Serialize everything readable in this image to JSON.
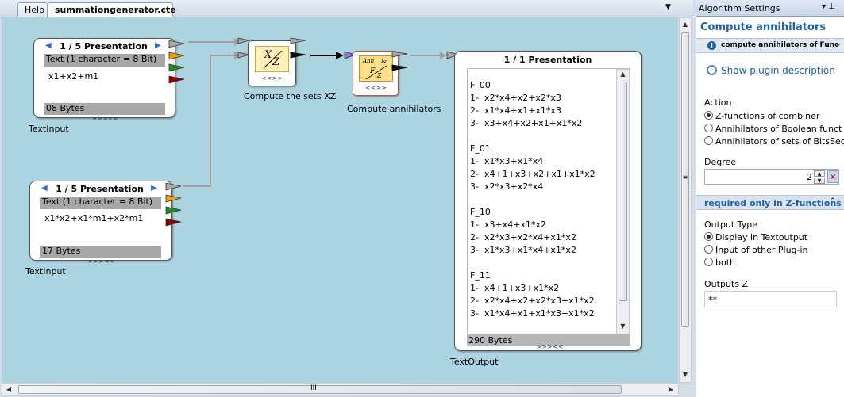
{
  "tabs": [
    {
      "label": "Help"
    },
    {
      "label": "summationgenerator.cte"
    }
  ],
  "tab_menu_glyph": "▼",
  "input1": {
    "title": "1 / 5 Presentation",
    "header": "Text (1 character = 8 Bit)",
    "content": "x1+x2+m1",
    "footer": "08 Bytes",
    "expander": ">>><<",
    "caption": "TextInput"
  },
  "input2": {
    "title": "1 / 5 Presentation",
    "header": "Text (1 character = 8 Bit)",
    "content": "x1*x2+x1*m1+x2*m1",
    "footer": "17 Bytes",
    "expander": ">>><<",
    "caption": "TextInput"
  },
  "plugin_xz": {
    "icon_x": "X",
    "icon_z": "Z",
    "ctrl": "<<>>",
    "caption": "Compute the sets XZ"
  },
  "plugin_ann": {
    "icon_top": "Ann",
    "icon_amp": "&",
    "icon_f": "F",
    "icon_z": "Z",
    "ctrl": "<<>>",
    "caption": "Compute annihilators"
  },
  "output": {
    "title": "1 / 1 Presentation",
    "lines": [
      "F_00",
      "1-  x2*x4+x2+x2*x3",
      "2-  x1*x4+x1+x1*x3",
      "3-  x3+x4+x2+x1+x1*x2",
      "",
      "F_01",
      "1-  x1*x3+x1*x4",
      "2-  x4+1+x3+x2+x1+x1*x2",
      "3-  x2*x3+x2*x4",
      "",
      "F_10",
      "1-  x3+x4+x1*x2",
      "2-  x2*x3+x2*x4+x1*x2",
      "3-  x1*x3+x1*x4+x1*x2",
      "",
      "F_11",
      "1-  x4+1+x3+x1*x2",
      "2-  x2*x4+x2+x2*x3+x1*x2",
      "3-  x1*x4+x1+x1*x3+x1*x2"
    ],
    "footer": "290 Bytes",
    "expander": ">>><<",
    "caption": "TextOutput"
  },
  "hscroll_grip": "III",
  "panel": {
    "header": "Algorithm Settings",
    "pin": "▾ ⊥",
    "title": "Compute annihilators",
    "info": "compute annihilators of Func",
    "show_desc": "Show plugin description",
    "action_label": "Action",
    "actions": [
      "Z-functions of combiner",
      "Annihilators of Boolean funct",
      "Annihilators of sets of BitsSec"
    ],
    "degree_label": "Degree",
    "degree_value": "2",
    "group": "required only in Z-functions",
    "output_type_label": "Output Type",
    "output_types": [
      "Display in Textoutput",
      "Input of other Plug-in",
      "both"
    ],
    "outputs_z_label": "Outputs Z",
    "outputs_z_value": "**"
  },
  "colors": {
    "canvas": "#add5e1",
    "accent_blue": "#1f5fa8",
    "orange_port": "#f0a000",
    "green_port": "#228b22",
    "red_port": "#8b0000",
    "purple_port": "#9370db"
  }
}
